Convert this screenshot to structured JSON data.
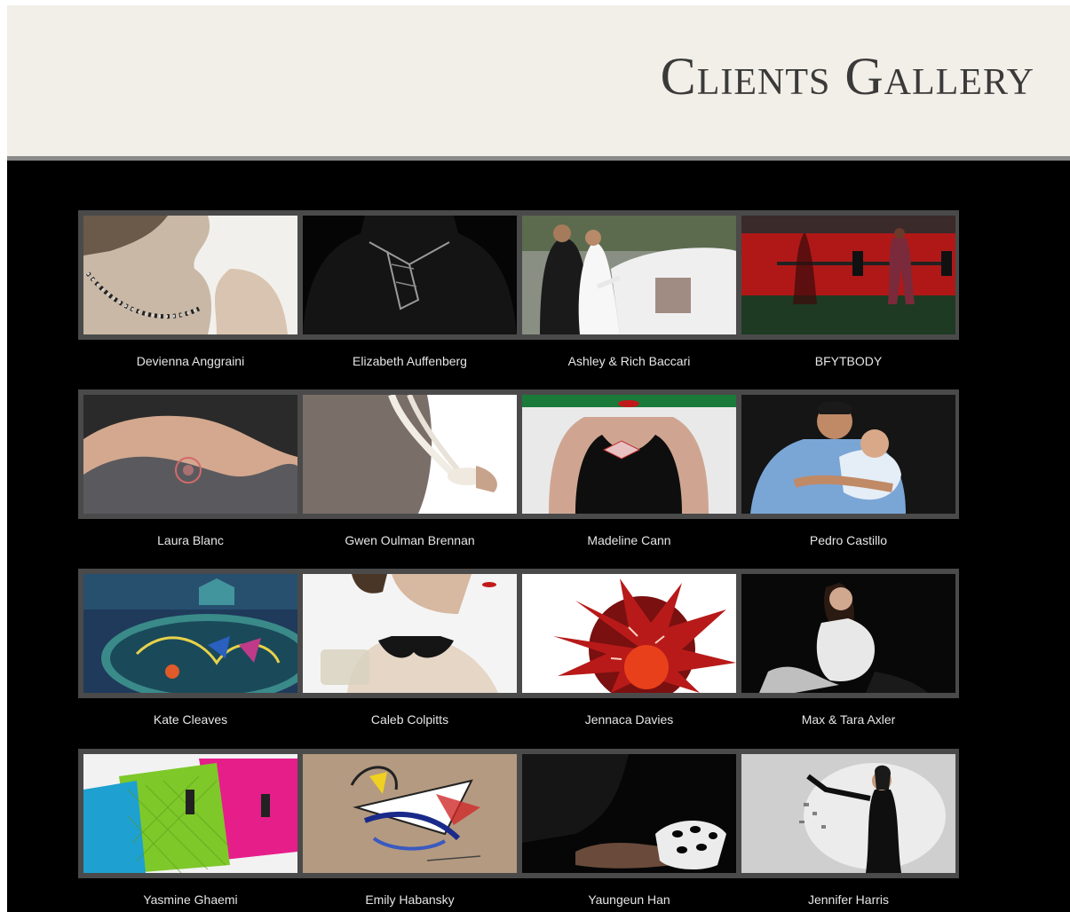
{
  "header": {
    "title": "Clients Gallery"
  },
  "gallery": {
    "clients": [
      {
        "name": "Devienna Anggraini",
        "photo": "woman-necklace-profile"
      },
      {
        "name": "Elizabeth Auffenberg",
        "photo": "black-top-silver-necklace"
      },
      {
        "name": "Ashley & Rich Baccari",
        "photo": "wedding-couple-car"
      },
      {
        "name": "BFYTBODY",
        "photo": "gym-red-wall"
      },
      {
        "name": "Laura Blanc",
        "photo": "shoulder-stamp"
      },
      {
        "name": "Gwen Oulman Brennan",
        "photo": "white-pendant"
      },
      {
        "name": "Madeline Cann",
        "photo": "black-dress-brooch"
      },
      {
        "name": "Pedro Castillo",
        "photo": "father-baby"
      },
      {
        "name": "Kate Cleaves",
        "photo": "painted-vase"
      },
      {
        "name": "Caleb Colpitts",
        "photo": "collar-necklace"
      },
      {
        "name": "Jennaca Davies",
        "photo": "red-spiky-sculpture"
      },
      {
        "name": "Max & Tara Axler",
        "photo": "maternity-portrait"
      },
      {
        "name": "Yasmine Ghaemi",
        "photo": "quilted-bags"
      },
      {
        "name": "Emily Habansky",
        "photo": "abstract-drawing"
      },
      {
        "name": "Yaungeun Han",
        "photo": "white-cuff-bracelet"
      },
      {
        "name": "Jennifer Harris",
        "photo": "woman-black-outfit"
      }
    ]
  }
}
